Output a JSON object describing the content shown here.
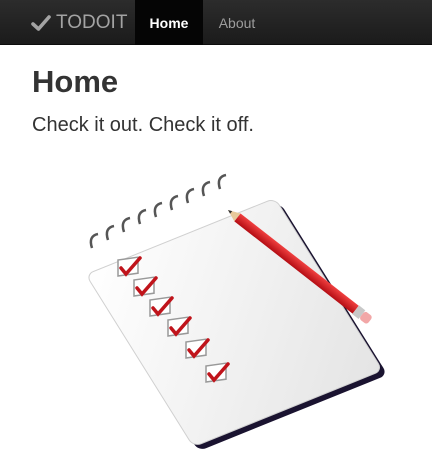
{
  "navbar": {
    "brand_icon": "check-icon",
    "brand_label": "TODOIT",
    "items": [
      {
        "label": "Home",
        "active": true
      },
      {
        "label": "About",
        "active": false
      }
    ]
  },
  "main": {
    "title": "Home",
    "tagline": "Check it out. Check it off."
  },
  "colors": {
    "navbar_bg": "#222222",
    "active_tab_bg": "#050505",
    "checkmark": "#c0141b",
    "pencil": "#d8141c"
  }
}
